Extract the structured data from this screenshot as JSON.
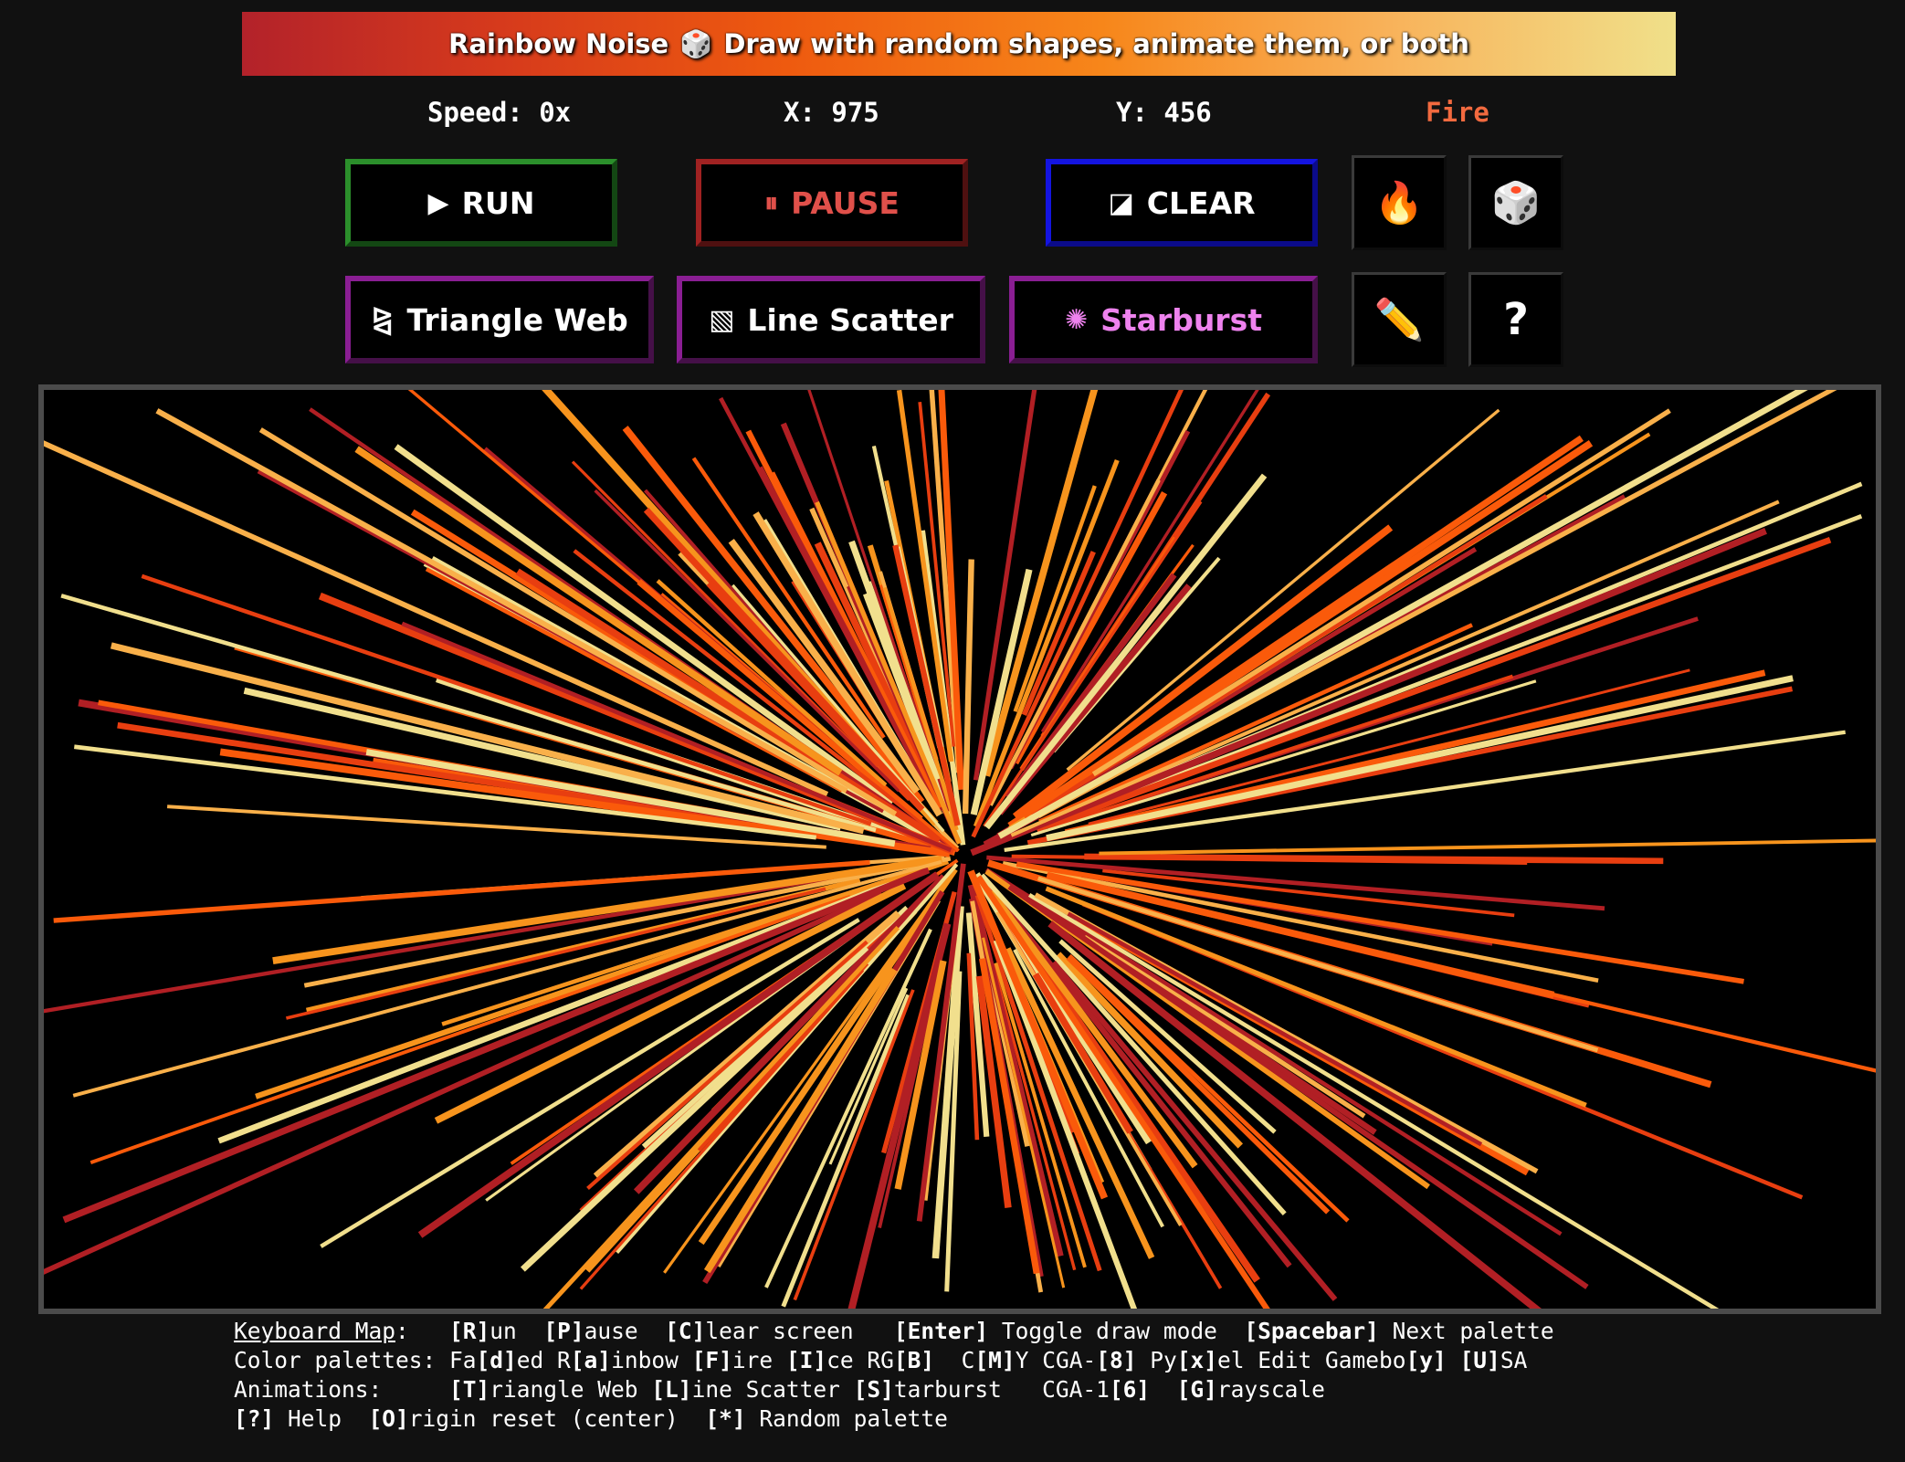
{
  "header": {
    "title_left": "Rainbow Noise",
    "die_icon": "🎲",
    "title_right": "Draw with random shapes, animate them, or both"
  },
  "status": {
    "speed": "Speed: 0x",
    "x": "X: 975",
    "y": "Y: 456",
    "palette": "Fire"
  },
  "controls": {
    "run": {
      "glyph": "▶",
      "label": "RUN"
    },
    "pause": {
      "glyph": "⏸",
      "label": "PAUSE"
    },
    "clear": {
      "glyph": "◪",
      "label": "CLEAR"
    },
    "fire_icon": "🔥",
    "random_icon": "🎲",
    "pencil_icon": "✏️",
    "help_icon": "?"
  },
  "animations": {
    "triangle_web": {
      "glyph": "⧎",
      "label": "Triangle Web"
    },
    "line_scatter": {
      "glyph": "▧",
      "label": "Line Scatter"
    },
    "starburst": {
      "glyph": "✺",
      "label": "Starburst"
    }
  },
  "canvas": {
    "mode": "starburst",
    "palette_colors": [
      "#b11f24",
      "#e83e10",
      "#fa5a0a",
      "#f7941d",
      "#f9b04a",
      "#f1df8d"
    ]
  },
  "keymap": {
    "label": "Keyboard Map",
    "line1_rest": ":   [R]un  [P]ause  [C]lear screen   [Enter] Toggle draw mode  [Spacebar] Next palette",
    "line2": "Color palettes: Fa[d]ed R[a]inbow [F]ire [I]ce RG[B]  C[M]Y CGA-[8] Py[x]el Edit Gamebo[y] [U]SA",
    "line3": "Animations:     [T]riangle Web [L]ine Scatter [S]tarburst   CGA-1[6]  [G]rayscale",
    "line4": "[?] Help  [O]rigin reset (center)  [*] Random palette"
  }
}
